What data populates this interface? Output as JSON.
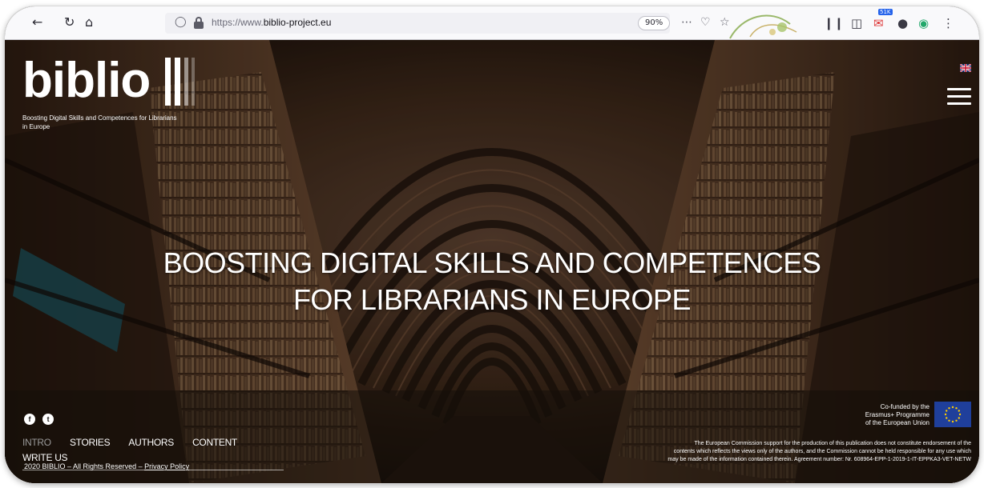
{
  "browser": {
    "url_prefix": "https://www.",
    "url_domain": "biblio-project.eu",
    "zoom": "90%",
    "icons": [
      "back-icon",
      "reload-icon",
      "home-icon",
      "shield-icon",
      "lock-icon",
      "more-icon",
      "pocket-icon",
      "star-icon",
      "library-icon",
      "sidebar-icon",
      "mail-icon",
      "account-icon",
      "extension-icon"
    ],
    "ext_badge": "51K"
  },
  "logo": {
    "word": "biblio",
    "tagline": "Boosting Digital Skills and Competences for Librarians in Europe"
  },
  "hero": {
    "line1": "BOOSTING DIGITAL SKILLS AND COMPETENCES",
    "line2": "FOR LIBRARIANS IN EUROPE"
  },
  "footer": {
    "social": {
      "facebook": "f",
      "twitter": "t"
    },
    "nav": [
      "INTRO",
      "STORIES",
      "AUTHORS",
      "CONTENT",
      "WRITE US"
    ],
    "active_nav": "INTRO",
    "copyright": "2020 BIBLIO – All Rights Reserved –",
    "privacy": "Privacy Policy",
    "cofund_line1": "Co-funded by the",
    "cofund_line2": "Erasmus+ Programme",
    "cofund_line3": "of the European Union",
    "disclaimer_line1": "The European Commission support for the production of this publication does not constitute endorsement of the",
    "disclaimer_line2": "contents which reflects the views only of the authors, and the Commission cannot be held responsible for any use which",
    "disclaimer_line3": "may be made of the information contained therein. Agreement number: Nr. 608964-EPP-1-2019-1-IT-EPPKA3-VET-NETW"
  },
  "colors": {
    "toolbar": "#f9f9fb",
    "eu_blue": "#1f3f9b",
    "eu_star": "#ffcc00",
    "hero_text": "#ffffff"
  }
}
